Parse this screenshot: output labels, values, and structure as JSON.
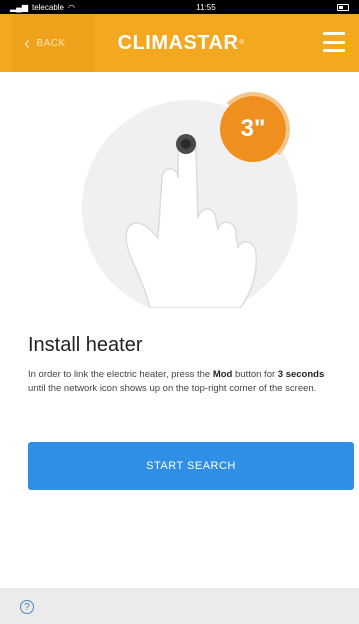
{
  "status_bar": {
    "carrier": "telecable",
    "time": "11:55"
  },
  "header": {
    "back_label": "BACK",
    "brand": "CLIMASTAR",
    "brand_mark": "®"
  },
  "illustration": {
    "timer": "3\""
  },
  "content": {
    "title": "Install heater",
    "desc_part1": "In order to link the electric heater, press the ",
    "desc_bold1": "Mod",
    "desc_part2": " button for ",
    "desc_bold2": "3 seconds",
    "desc_part3": " until the network icon shows up on the top-right corner of the screen."
  },
  "actions": {
    "start_search": "START SEARCH"
  },
  "colors": {
    "header_bg": "#f3a81f",
    "button_bg": "#2f8ee5",
    "timer_bg": "#ef8f1e"
  }
}
